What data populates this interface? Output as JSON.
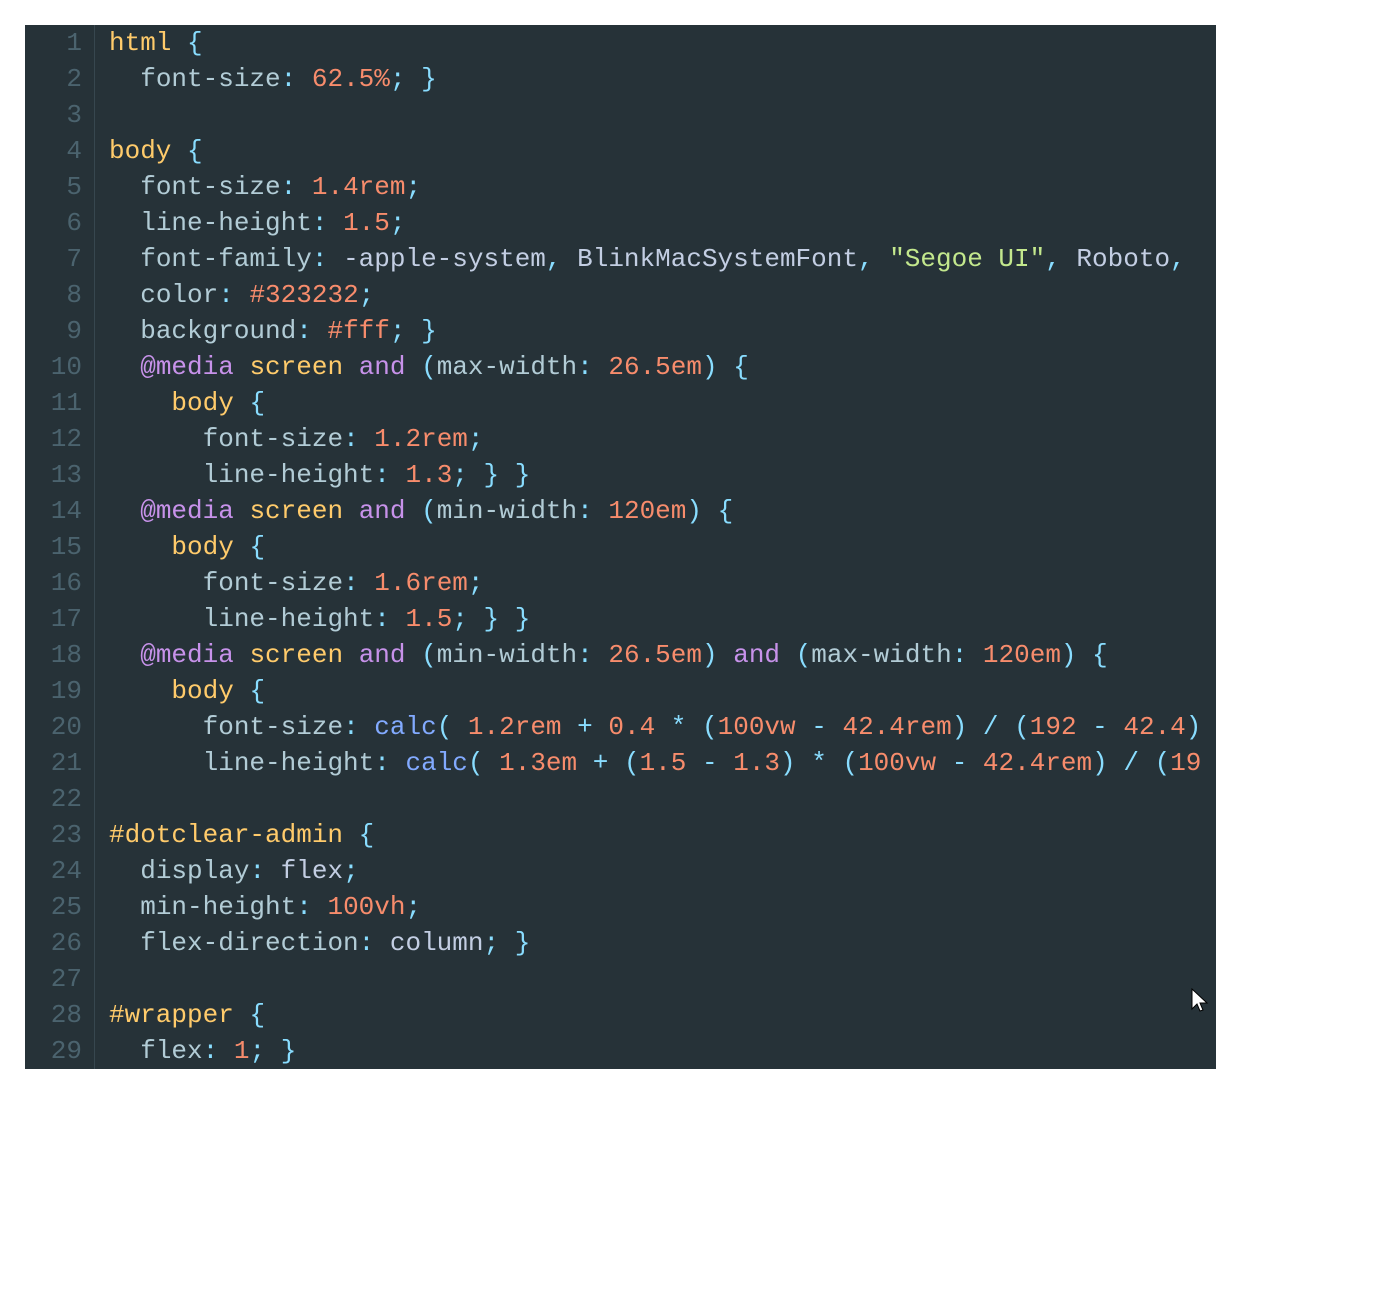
{
  "editor": {
    "theme": "material-dark",
    "colors": {
      "background": "#263238",
      "gutter_fg": "#4b636e",
      "default_fg": "#c3cee3",
      "selector": "#ffcb6b",
      "property": "#b2ccd6",
      "number": "#f78c6c",
      "keyword": "#c792ea",
      "punctuation": "#89ddff",
      "string": "#c3e88d",
      "function": "#82aaff"
    },
    "lines": [
      {
        "n": 1,
        "tokens": [
          [
            "tag",
            "html"
          ],
          [
            "val",
            " "
          ],
          [
            "op",
            "{"
          ]
        ]
      },
      {
        "n": 2,
        "tokens": [
          [
            "val",
            "  "
          ],
          [
            "prop",
            "font-size"
          ],
          [
            "op",
            ":"
          ],
          [
            "val",
            " "
          ],
          [
            "num",
            "62.5%"
          ],
          [
            "op",
            ";"
          ],
          [
            "val",
            " "
          ],
          [
            "op",
            "}"
          ]
        ]
      },
      {
        "n": 3,
        "tokens": []
      },
      {
        "n": 4,
        "tokens": [
          [
            "tag",
            "body"
          ],
          [
            "val",
            " "
          ],
          [
            "op",
            "{"
          ]
        ]
      },
      {
        "n": 5,
        "tokens": [
          [
            "val",
            "  "
          ],
          [
            "prop",
            "font-size"
          ],
          [
            "op",
            ":"
          ],
          [
            "val",
            " "
          ],
          [
            "num",
            "1.4rem"
          ],
          [
            "op",
            ";"
          ]
        ]
      },
      {
        "n": 6,
        "tokens": [
          [
            "val",
            "  "
          ],
          [
            "prop",
            "line-height"
          ],
          [
            "op",
            ":"
          ],
          [
            "val",
            " "
          ],
          [
            "num",
            "1.5"
          ],
          [
            "op",
            ";"
          ]
        ]
      },
      {
        "n": 7,
        "tokens": [
          [
            "val",
            "  "
          ],
          [
            "prop",
            "font-family"
          ],
          [
            "op",
            ":"
          ],
          [
            "val",
            " -apple-system"
          ],
          [
            "op",
            ","
          ],
          [
            "val",
            " BlinkMacSystemFont"
          ],
          [
            "op",
            ","
          ],
          [
            "val",
            " "
          ],
          [
            "str",
            "\"Segoe UI\""
          ],
          [
            "op",
            ","
          ],
          [
            "val",
            " Roboto"
          ],
          [
            "op",
            ","
          ]
        ]
      },
      {
        "n": 8,
        "tokens": [
          [
            "val",
            "  "
          ],
          [
            "prop",
            "color"
          ],
          [
            "op",
            ":"
          ],
          [
            "val",
            " "
          ],
          [
            "num",
            "#323232"
          ],
          [
            "op",
            ";"
          ]
        ]
      },
      {
        "n": 9,
        "tokens": [
          [
            "val",
            "  "
          ],
          [
            "prop",
            "background"
          ],
          [
            "op",
            ":"
          ],
          [
            "val",
            " "
          ],
          [
            "num",
            "#fff"
          ],
          [
            "op",
            ";"
          ],
          [
            "val",
            " "
          ],
          [
            "op",
            "}"
          ]
        ]
      },
      {
        "n": 10,
        "tokens": [
          [
            "val",
            "  "
          ],
          [
            "kw",
            "@media"
          ],
          [
            "val",
            " "
          ],
          [
            "tag",
            "screen"
          ],
          [
            "val",
            " "
          ],
          [
            "kw",
            "and"
          ],
          [
            "val",
            " "
          ],
          [
            "op",
            "("
          ],
          [
            "prop",
            "max-width"
          ],
          [
            "op",
            ":"
          ],
          [
            "val",
            " "
          ],
          [
            "num",
            "26.5em"
          ],
          [
            "op",
            ")"
          ],
          [
            "val",
            " "
          ],
          [
            "op",
            "{"
          ]
        ]
      },
      {
        "n": 11,
        "tokens": [
          [
            "val",
            "    "
          ],
          [
            "tag",
            "body"
          ],
          [
            "val",
            " "
          ],
          [
            "op",
            "{"
          ]
        ]
      },
      {
        "n": 12,
        "tokens": [
          [
            "val",
            "      "
          ],
          [
            "prop",
            "font-size"
          ],
          [
            "op",
            ":"
          ],
          [
            "val",
            " "
          ],
          [
            "num",
            "1.2rem"
          ],
          [
            "op",
            ";"
          ]
        ]
      },
      {
        "n": 13,
        "tokens": [
          [
            "val",
            "      "
          ],
          [
            "prop",
            "line-height"
          ],
          [
            "op",
            ":"
          ],
          [
            "val",
            " "
          ],
          [
            "num",
            "1.3"
          ],
          [
            "op",
            ";"
          ],
          [
            "val",
            " "
          ],
          [
            "op",
            "}"
          ],
          [
            "val",
            " "
          ],
          [
            "op",
            "}"
          ]
        ]
      },
      {
        "n": 14,
        "tokens": [
          [
            "val",
            "  "
          ],
          [
            "kw",
            "@media"
          ],
          [
            "val",
            " "
          ],
          [
            "tag",
            "screen"
          ],
          [
            "val",
            " "
          ],
          [
            "kw",
            "and"
          ],
          [
            "val",
            " "
          ],
          [
            "op",
            "("
          ],
          [
            "prop",
            "min-width"
          ],
          [
            "op",
            ":"
          ],
          [
            "val",
            " "
          ],
          [
            "num",
            "120em"
          ],
          [
            "op",
            ")"
          ],
          [
            "val",
            " "
          ],
          [
            "op",
            "{"
          ]
        ]
      },
      {
        "n": 15,
        "tokens": [
          [
            "val",
            "    "
          ],
          [
            "tag",
            "body"
          ],
          [
            "val",
            " "
          ],
          [
            "op",
            "{"
          ]
        ]
      },
      {
        "n": 16,
        "tokens": [
          [
            "val",
            "      "
          ],
          [
            "prop",
            "font-size"
          ],
          [
            "op",
            ":"
          ],
          [
            "val",
            " "
          ],
          [
            "num",
            "1.6rem"
          ],
          [
            "op",
            ";"
          ]
        ]
      },
      {
        "n": 17,
        "tokens": [
          [
            "val",
            "      "
          ],
          [
            "prop",
            "line-height"
          ],
          [
            "op",
            ":"
          ],
          [
            "val",
            " "
          ],
          [
            "num",
            "1.5"
          ],
          [
            "op",
            ";"
          ],
          [
            "val",
            " "
          ],
          [
            "op",
            "}"
          ],
          [
            "val",
            " "
          ],
          [
            "op",
            "}"
          ]
        ]
      },
      {
        "n": 18,
        "tokens": [
          [
            "val",
            "  "
          ],
          [
            "kw",
            "@media"
          ],
          [
            "val",
            " "
          ],
          [
            "tag",
            "screen"
          ],
          [
            "val",
            " "
          ],
          [
            "kw",
            "and"
          ],
          [
            "val",
            " "
          ],
          [
            "op",
            "("
          ],
          [
            "prop",
            "min-width"
          ],
          [
            "op",
            ":"
          ],
          [
            "val",
            " "
          ],
          [
            "num",
            "26.5em"
          ],
          [
            "op",
            ")"
          ],
          [
            "val",
            " "
          ],
          [
            "kw",
            "and"
          ],
          [
            "val",
            " "
          ],
          [
            "op",
            "("
          ],
          [
            "prop",
            "max-width"
          ],
          [
            "op",
            ":"
          ],
          [
            "val",
            " "
          ],
          [
            "num",
            "120em"
          ],
          [
            "op",
            ")"
          ],
          [
            "val",
            " "
          ],
          [
            "op",
            "{"
          ]
        ]
      },
      {
        "n": 19,
        "tokens": [
          [
            "val",
            "    "
          ],
          [
            "tag",
            "body"
          ],
          [
            "val",
            " "
          ],
          [
            "op",
            "{"
          ]
        ]
      },
      {
        "n": 20,
        "tokens": [
          [
            "val",
            "      "
          ],
          [
            "prop",
            "font-size"
          ],
          [
            "op",
            ":"
          ],
          [
            "val",
            " "
          ],
          [
            "func",
            "calc"
          ],
          [
            "op",
            "("
          ],
          [
            "val",
            " "
          ],
          [
            "num",
            "1.2rem"
          ],
          [
            "val",
            " "
          ],
          [
            "op",
            "+"
          ],
          [
            "val",
            " "
          ],
          [
            "num",
            "0.4"
          ],
          [
            "val",
            " "
          ],
          [
            "op",
            "*"
          ],
          [
            "val",
            " "
          ],
          [
            "op",
            "("
          ],
          [
            "num",
            "100vw"
          ],
          [
            "val",
            " "
          ],
          [
            "op",
            "-"
          ],
          [
            "val",
            " "
          ],
          [
            "num",
            "42.4rem"
          ],
          [
            "op",
            ")"
          ],
          [
            "val",
            " "
          ],
          [
            "op",
            "/"
          ],
          [
            "val",
            " "
          ],
          [
            "op",
            "("
          ],
          [
            "num",
            "192"
          ],
          [
            "val",
            " "
          ],
          [
            "op",
            "-"
          ],
          [
            "val",
            " "
          ],
          [
            "num",
            "42.4"
          ],
          [
            "op",
            ")"
          ]
        ]
      },
      {
        "n": 21,
        "tokens": [
          [
            "val",
            "      "
          ],
          [
            "prop",
            "line-height"
          ],
          [
            "op",
            ":"
          ],
          [
            "val",
            " "
          ],
          [
            "func",
            "calc"
          ],
          [
            "op",
            "("
          ],
          [
            "val",
            " "
          ],
          [
            "num",
            "1.3em"
          ],
          [
            "val",
            " "
          ],
          [
            "op",
            "+"
          ],
          [
            "val",
            " "
          ],
          [
            "op",
            "("
          ],
          [
            "num",
            "1.5"
          ],
          [
            "val",
            " "
          ],
          [
            "op",
            "-"
          ],
          [
            "val",
            " "
          ],
          [
            "num",
            "1.3"
          ],
          [
            "op",
            ")"
          ],
          [
            "val",
            " "
          ],
          [
            "op",
            "*"
          ],
          [
            "val",
            " "
          ],
          [
            "op",
            "("
          ],
          [
            "num",
            "100vw"
          ],
          [
            "val",
            " "
          ],
          [
            "op",
            "-"
          ],
          [
            "val",
            " "
          ],
          [
            "num",
            "42.4rem"
          ],
          [
            "op",
            ")"
          ],
          [
            "val",
            " "
          ],
          [
            "op",
            "/"
          ],
          [
            "val",
            " "
          ],
          [
            "op",
            "("
          ],
          [
            "num",
            "19"
          ]
        ]
      },
      {
        "n": 22,
        "tokens": []
      },
      {
        "n": 23,
        "tokens": [
          [
            "id",
            "#dotclear-admin"
          ],
          [
            "val",
            " "
          ],
          [
            "op",
            "{"
          ]
        ]
      },
      {
        "n": 24,
        "tokens": [
          [
            "val",
            "  "
          ],
          [
            "prop",
            "display"
          ],
          [
            "op",
            ":"
          ],
          [
            "val",
            " flex"
          ],
          [
            "op",
            ";"
          ]
        ]
      },
      {
        "n": 25,
        "tokens": [
          [
            "val",
            "  "
          ],
          [
            "prop",
            "min-height"
          ],
          [
            "op",
            ":"
          ],
          [
            "val",
            " "
          ],
          [
            "num",
            "100vh"
          ],
          [
            "op",
            ";"
          ]
        ]
      },
      {
        "n": 26,
        "tokens": [
          [
            "val",
            "  "
          ],
          [
            "prop",
            "flex-direction"
          ],
          [
            "op",
            ":"
          ],
          [
            "val",
            " column"
          ],
          [
            "op",
            ";"
          ],
          [
            "val",
            " "
          ],
          [
            "op",
            "}"
          ]
        ]
      },
      {
        "n": 27,
        "tokens": []
      },
      {
        "n": 28,
        "tokens": [
          [
            "id",
            "#wrapper"
          ],
          [
            "val",
            " "
          ],
          [
            "op",
            "{"
          ]
        ]
      },
      {
        "n": 29,
        "tokens": [
          [
            "val",
            "  "
          ],
          [
            "prop",
            "flex"
          ],
          [
            "op",
            ":"
          ],
          [
            "val",
            " "
          ],
          [
            "num",
            "1"
          ],
          [
            "op",
            ";"
          ],
          [
            "val",
            " "
          ],
          [
            "op",
            "}"
          ]
        ]
      }
    ]
  }
}
